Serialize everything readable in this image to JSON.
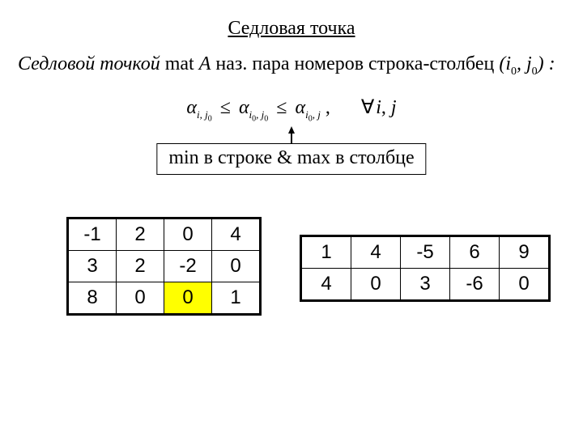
{
  "title": "Седловая точка",
  "definition": {
    "prefix_italic": "Седловой точкой",
    "mid": " mat ",
    "A": "A",
    "tail": " наз. пара номеров строка-столбец ",
    "pair_open": "(",
    "i": "i",
    "i_sub": "0",
    "comma": ", ",
    "j": "j",
    "j_sub": "0",
    "pair_close": ") :"
  },
  "inequality": {
    "alpha": "α",
    "i": "i",
    "j": "j",
    "i0": "i",
    "j0": "j",
    "zero": "0",
    "le": "≤",
    "comma": ",",
    "forall": "∀",
    "sep": ", "
  },
  "boxnote": "min в строке & max в столбце",
  "matrix1": {
    "rows": [
      [
        "-1",
        "2",
        "0",
        "4"
      ],
      [
        "3",
        "2",
        "-2",
        "0"
      ],
      [
        "8",
        "0",
        "0",
        "1"
      ]
    ],
    "highlight": {
      "r": 2,
      "c": 2
    }
  },
  "matrix2": {
    "rows": [
      [
        "1",
        "4",
        "-5",
        "6",
        "9"
      ],
      [
        "4",
        "0",
        "3",
        "-6",
        "0"
      ]
    ]
  }
}
